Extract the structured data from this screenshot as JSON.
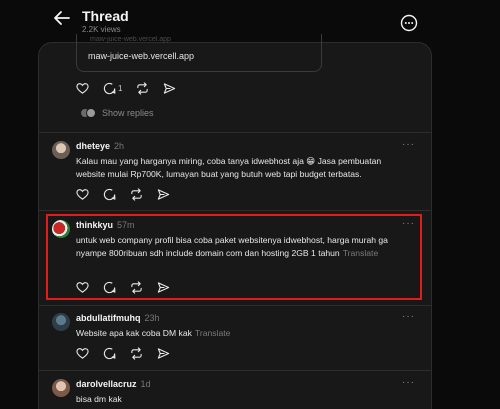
{
  "header": {
    "title": "Thread",
    "views": "2.2K views"
  },
  "prev_post": {
    "link_faded": "maw-juice-web.vercel.app",
    "link_text": "maw-juice-web.vercell.app",
    "reply_count": "1",
    "show_replies": "Show replies"
  },
  "replies": [
    {
      "username": "dheteye",
      "time": "2h",
      "text": "Kalau mau yang harganya miring, coba tanya idwebhost aja 😁 Jasa pembuatan website mulai Rp700K, lumayan buat yang butuh web tapi budget terbatas.",
      "translate": ""
    },
    {
      "username": "thinkkyu",
      "time": "57m",
      "text": "untuk web company profil bisa coba paket websitenya idwebhost, harga murah ga nyampe 800ribuan sdh include domain com dan hosting 2GB 1 tahun",
      "translate": "Translate"
    },
    {
      "username": "abdullatifmuhq",
      "time": "23h",
      "text": "Website apa kak coba DM kak",
      "translate": "Translate"
    },
    {
      "username": "darolvellacruz",
      "time": "1d",
      "text": "bisa dm kak",
      "translate": ""
    }
  ],
  "colors": {
    "highlight": "#e21b1b",
    "background": "#0a0a0a",
    "card": "#181818"
  },
  "icons": [
    "back-arrow-icon",
    "more-circle-icon",
    "heart-icon",
    "comment-icon",
    "repost-icon",
    "share-icon"
  ]
}
